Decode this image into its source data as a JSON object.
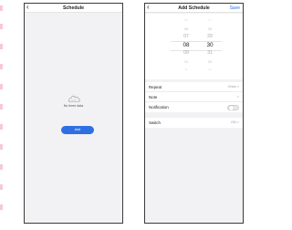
{
  "colors": {
    "accent": "#2f6fe4",
    "phone_background": "#f2f2f4",
    "margin_marks": "#f6c8d8"
  },
  "schedule_screen": {
    "back_icon": "chevron-left-icon",
    "title": "Schedule",
    "empty_icon": "cloud-icon",
    "empty_text": "No timer data",
    "add_label": "Add"
  },
  "add_schedule_screen": {
    "back_icon": "chevron-left-icon",
    "title": "Add Schedule",
    "save_label": "Save",
    "picker": {
      "hours": [
        "05",
        "06",
        "07",
        "08",
        "09",
        "10",
        "11"
      ],
      "minutes": [
        "27",
        "28",
        "29",
        "30",
        "31",
        "32",
        "33"
      ],
      "selected_hour": "08",
      "selected_minute": "30"
    },
    "rows": {
      "repeat": {
        "label": "Repeat",
        "value": "Once >"
      },
      "note": {
        "label": "Note",
        "value": ">"
      },
      "notification": {
        "label": "Notification",
        "enabled": false
      },
      "switch": {
        "label": "Switch",
        "value": "ON >"
      }
    }
  }
}
